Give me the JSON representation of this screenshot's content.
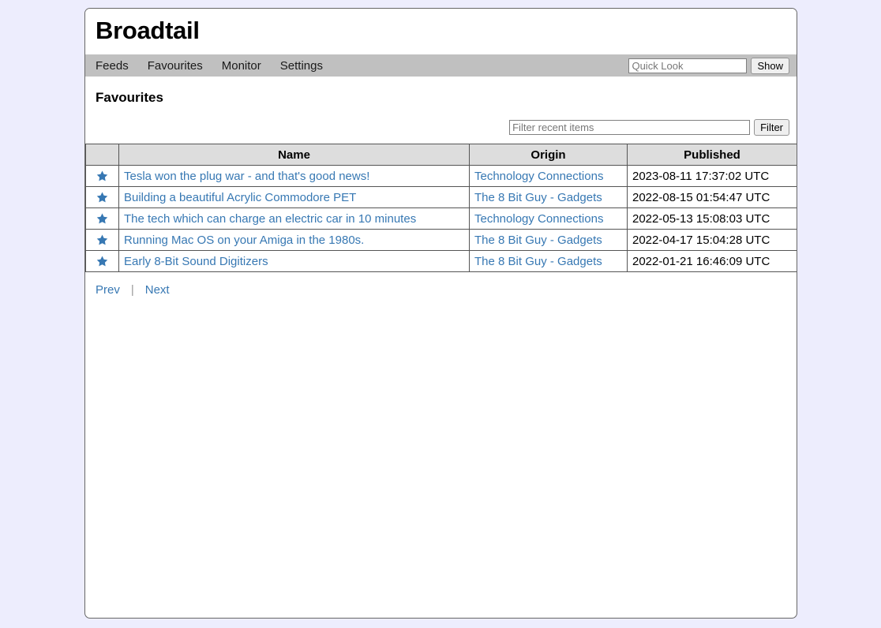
{
  "app": {
    "title": "Broadtail",
    "background_color": "#ededfd",
    "card_background": "#ffffff",
    "navbar_color": "#c0c0c0",
    "link_color": "#3778b3",
    "star_color": "#3778b3",
    "table_header_color": "#dddddd"
  },
  "nav": {
    "items": [
      {
        "label": "Feeds"
      },
      {
        "label": "Favourites"
      },
      {
        "label": "Monitor"
      },
      {
        "label": "Settings"
      }
    ],
    "quick_look": {
      "placeholder": "Quick Look",
      "value": "",
      "button_label": "Show"
    }
  },
  "page": {
    "heading": "Favourites",
    "filter": {
      "placeholder": "Filter recent items",
      "value": "",
      "button_label": "Filter"
    }
  },
  "table": {
    "columns": [
      {
        "key": "star",
        "label": ""
      },
      {
        "key": "name",
        "label": "Name"
      },
      {
        "key": "origin",
        "label": "Origin"
      },
      {
        "key": "published",
        "label": "Published"
      }
    ],
    "rows": [
      {
        "favourite_icon": "star-icon",
        "name": "Tesla won the plug war - and that's good news!",
        "origin": "Technology Connections",
        "published": "2023-08-11 17:37:02 UTC"
      },
      {
        "favourite_icon": "star-icon",
        "name": "Building a beautiful Acrylic Commodore PET",
        "origin": "The 8 Bit Guy - Gadgets",
        "published": "2022-08-15 01:54:47 UTC"
      },
      {
        "favourite_icon": "star-icon",
        "name": "The tech which can charge an electric car in 10 minutes",
        "origin": "Technology Connections",
        "published": "2022-05-13 15:08:03 UTC"
      },
      {
        "favourite_icon": "star-icon",
        "name": "Running Mac OS on your Amiga in the 1980s.",
        "origin": "The 8 Bit Guy - Gadgets",
        "published": "2022-04-17 15:04:28 UTC"
      },
      {
        "favourite_icon": "star-icon",
        "name": "Early 8-Bit Sound Digitizers",
        "origin": "The 8 Bit Guy - Gadgets",
        "published": "2022-01-21 16:46:09 UTC"
      }
    ]
  },
  "pager": {
    "prev_label": "Prev",
    "separator": "|",
    "next_label": "Next"
  }
}
